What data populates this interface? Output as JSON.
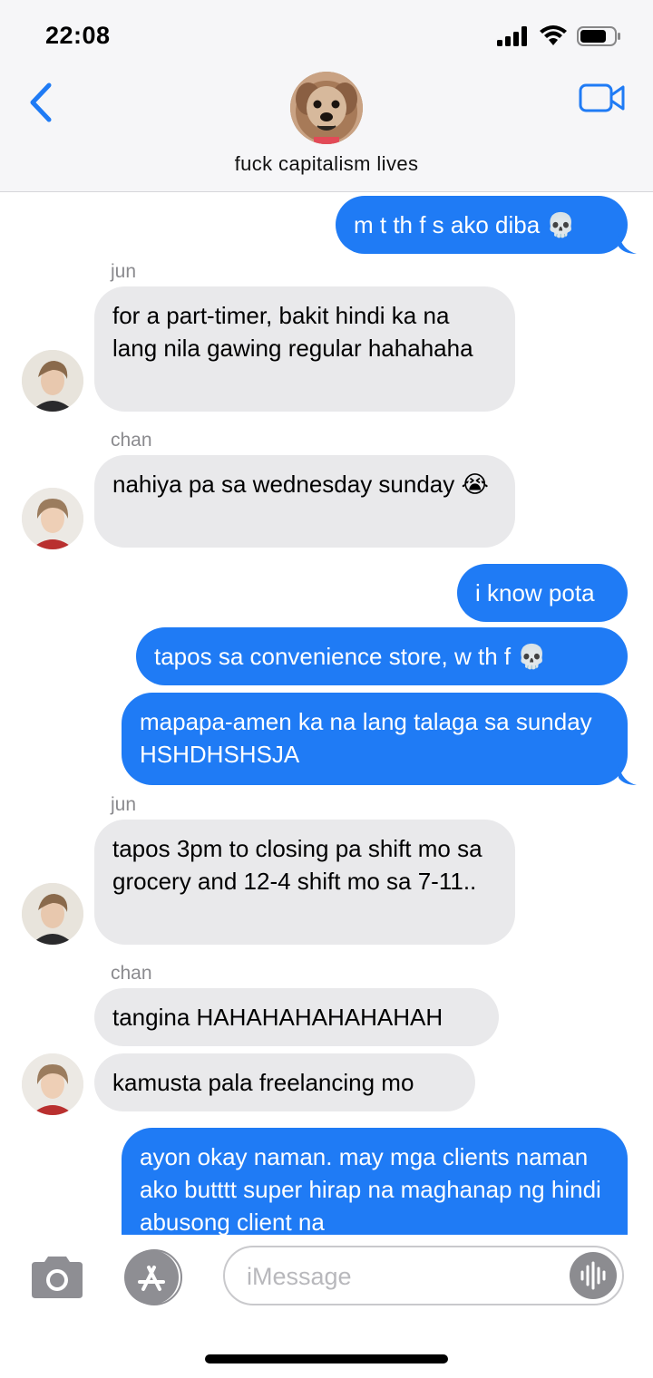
{
  "status_bar": {
    "time": "22:08"
  },
  "header": {
    "group_name": "fuck capitalism lives"
  },
  "messages": [
    {
      "text": "m t th f s ako diba 💀"
    },
    {
      "sender": "jun",
      "text": "for a part-timer, bakit hindi ka na lang nila gawing regular hahahaha"
    },
    {
      "sender": "chan",
      "text": "nahiya pa sa wednesday sunday 😭"
    },
    {
      "text": "i know pota"
    },
    {
      "text": "tapos sa convenience store, w th f 💀"
    },
    {
      "text": "mapapa-amen ka na lang talaga sa sunday HSHDHSHSJA"
    },
    {
      "sender": "jun",
      "text": "tapos 3pm to closing pa shift mo sa grocery and 12-4 shift mo sa 7-11.."
    },
    {
      "sender": "chan",
      "text": "tangina HAHAHAHAHAHAHAH"
    },
    {
      "text": "kamusta pala freelancing mo"
    },
    {
      "text": "ayon okay naman. may mga clients naman ako butttt super hirap na maghanap ng hindi abusong client na"
    }
  ],
  "input": {
    "placeholder": "iMessage"
  },
  "icons": {
    "back": "chevron-left-icon",
    "video": "video-camera-icon",
    "camera": "camera-icon",
    "appstore": "app-store-icon",
    "audio": "audio-waveform-icon"
  },
  "colors": {
    "outgoing_bubble": "#1f7bf5",
    "incoming_bubble": "#e9e9eb",
    "accent": "#1f7bf5",
    "sender_label": "#8a8a8e"
  }
}
